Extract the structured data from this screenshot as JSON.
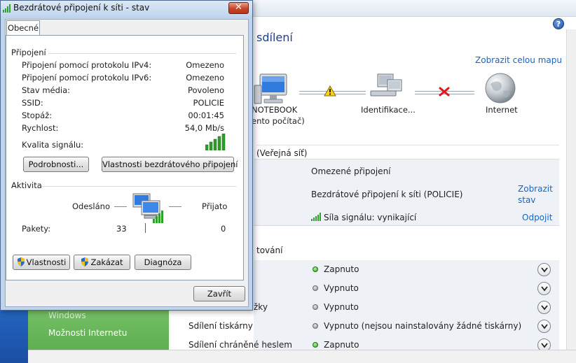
{
  "background": {
    "title": "sdílení",
    "help_glyph": "?",
    "map_link": "Zobrazit celou mapu",
    "nodes": [
      {
        "label_line1": "NOTEBOOK",
        "label_line2": "ento počítač)",
        "icon": "computer-icon"
      },
      {
        "label_line1": "Identifikace...",
        "label_line2": "",
        "icon": "network-icon"
      },
      {
        "label_line1": "Internet",
        "label_line2": "",
        "icon": "globe-icon"
      }
    ],
    "network_label": "(Veřejná síť)",
    "connection": {
      "access": "Omezené připojení",
      "connection_name": "Bezdrátové připojení k síti (POLICIE)",
      "signal": "Síla signálu: vynikající",
      "show_status_line1": "Zobrazit",
      "show_status_line2": "stav",
      "disconnect": "Odpojit"
    },
    "sharing_heading": "tování",
    "sharing_rows": [
      {
        "label": "",
        "status": "Zapnuto",
        "on": true
      },
      {
        "label": "",
        "status": "Vypnuto",
        "on": false
      },
      {
        "label": "žky",
        "status": "Vypnuto",
        "on": false
      },
      {
        "label": "Sdílení tiskárny",
        "status": "Vypnuto (nejsou nainstalovány žádné tiskárny)",
        "on": false
      },
      {
        "label": "Sdílení chráněné heslem",
        "status": "Zapnuto",
        "on": true
      }
    ],
    "left_nav": [
      "Windows",
      "Možnosti Internetu"
    ]
  },
  "dialog": {
    "title": "Bezdrátové připojení k síti - stav",
    "close_glyph": "✕",
    "tab": "Obecné",
    "connection_group": "Připojení",
    "rows": [
      {
        "label": "Připojení pomocí protokolu IPv4:",
        "value": "Omezeno"
      },
      {
        "label": "Připojení pomocí protokolu IPv6:",
        "value": "Omezeno"
      },
      {
        "label": "Stav média:",
        "value": "Povoleno"
      },
      {
        "label": "SSID:",
        "value": "POLICIE"
      },
      {
        "label": "Stopáž:",
        "value": "00:01:45"
      },
      {
        "label": "Rychlost:",
        "value": "54,0 Mb/s"
      }
    ],
    "signal_quality_label": "Kvalita signálu:",
    "details_button": "Podrobnosti...",
    "wireless_props_button": "Vlastnosti bezdrátového připojení",
    "activity_group": "Aktivita",
    "sent_label": "Odesláno",
    "received_label": "Přijato",
    "packets_label": "Pakety:",
    "packets_sent": "33",
    "packets_received": "0",
    "properties_button": "Vlastnosti",
    "disable_button": "Zakázat",
    "diagnose_button": "Diagnóza",
    "close_button": "Zavřít"
  }
}
